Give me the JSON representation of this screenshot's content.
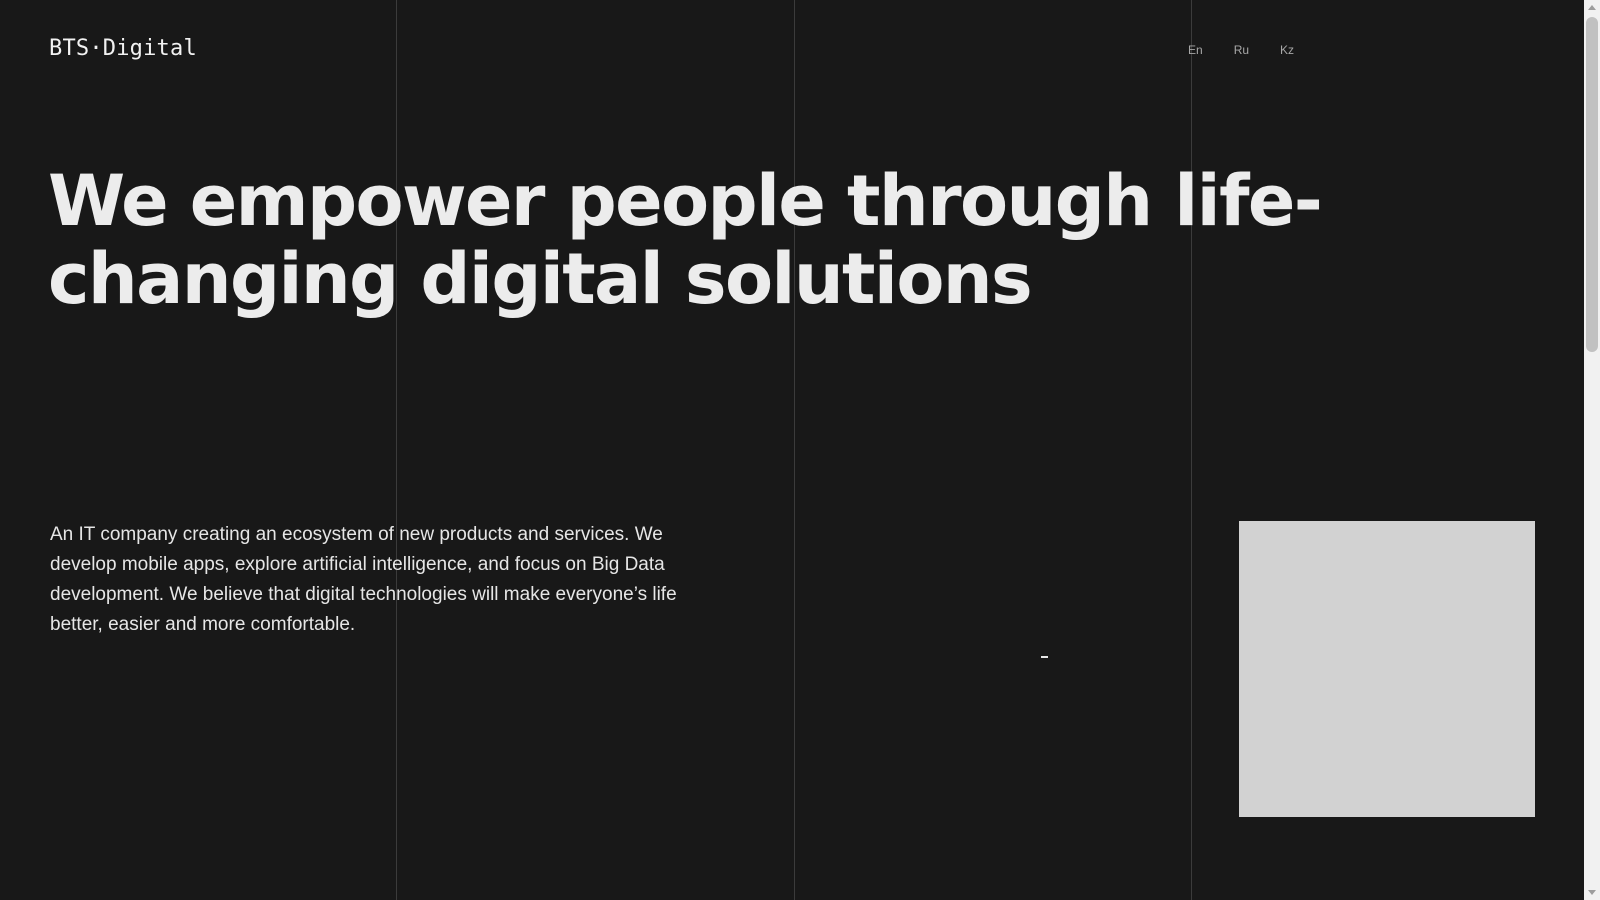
{
  "header": {
    "logo_text": "BTS·Digital",
    "languages": [
      "En",
      "Ru",
      "Kz"
    ]
  },
  "hero": {
    "title": "We empower people through life-changing digital solutions",
    "description": "An IT company creating an ecosystem of new products and services. We develop mobile apps, explore artificial intelligence, and focus on Big Data development. We believe that digital technologies will make everyone’s life better, easier and more comfortable."
  },
  "scrollbar": {
    "position_fraction": 0
  },
  "colors": {
    "background": "#181818",
    "grid_line": "#3b3b3b",
    "text": "#ececec",
    "muted_text": "#a7a7a7",
    "media_panel": "#d2d2d2",
    "scrollbar_track": "#f1f1f1",
    "scrollbar_thumb": "#c1c1c1"
  }
}
